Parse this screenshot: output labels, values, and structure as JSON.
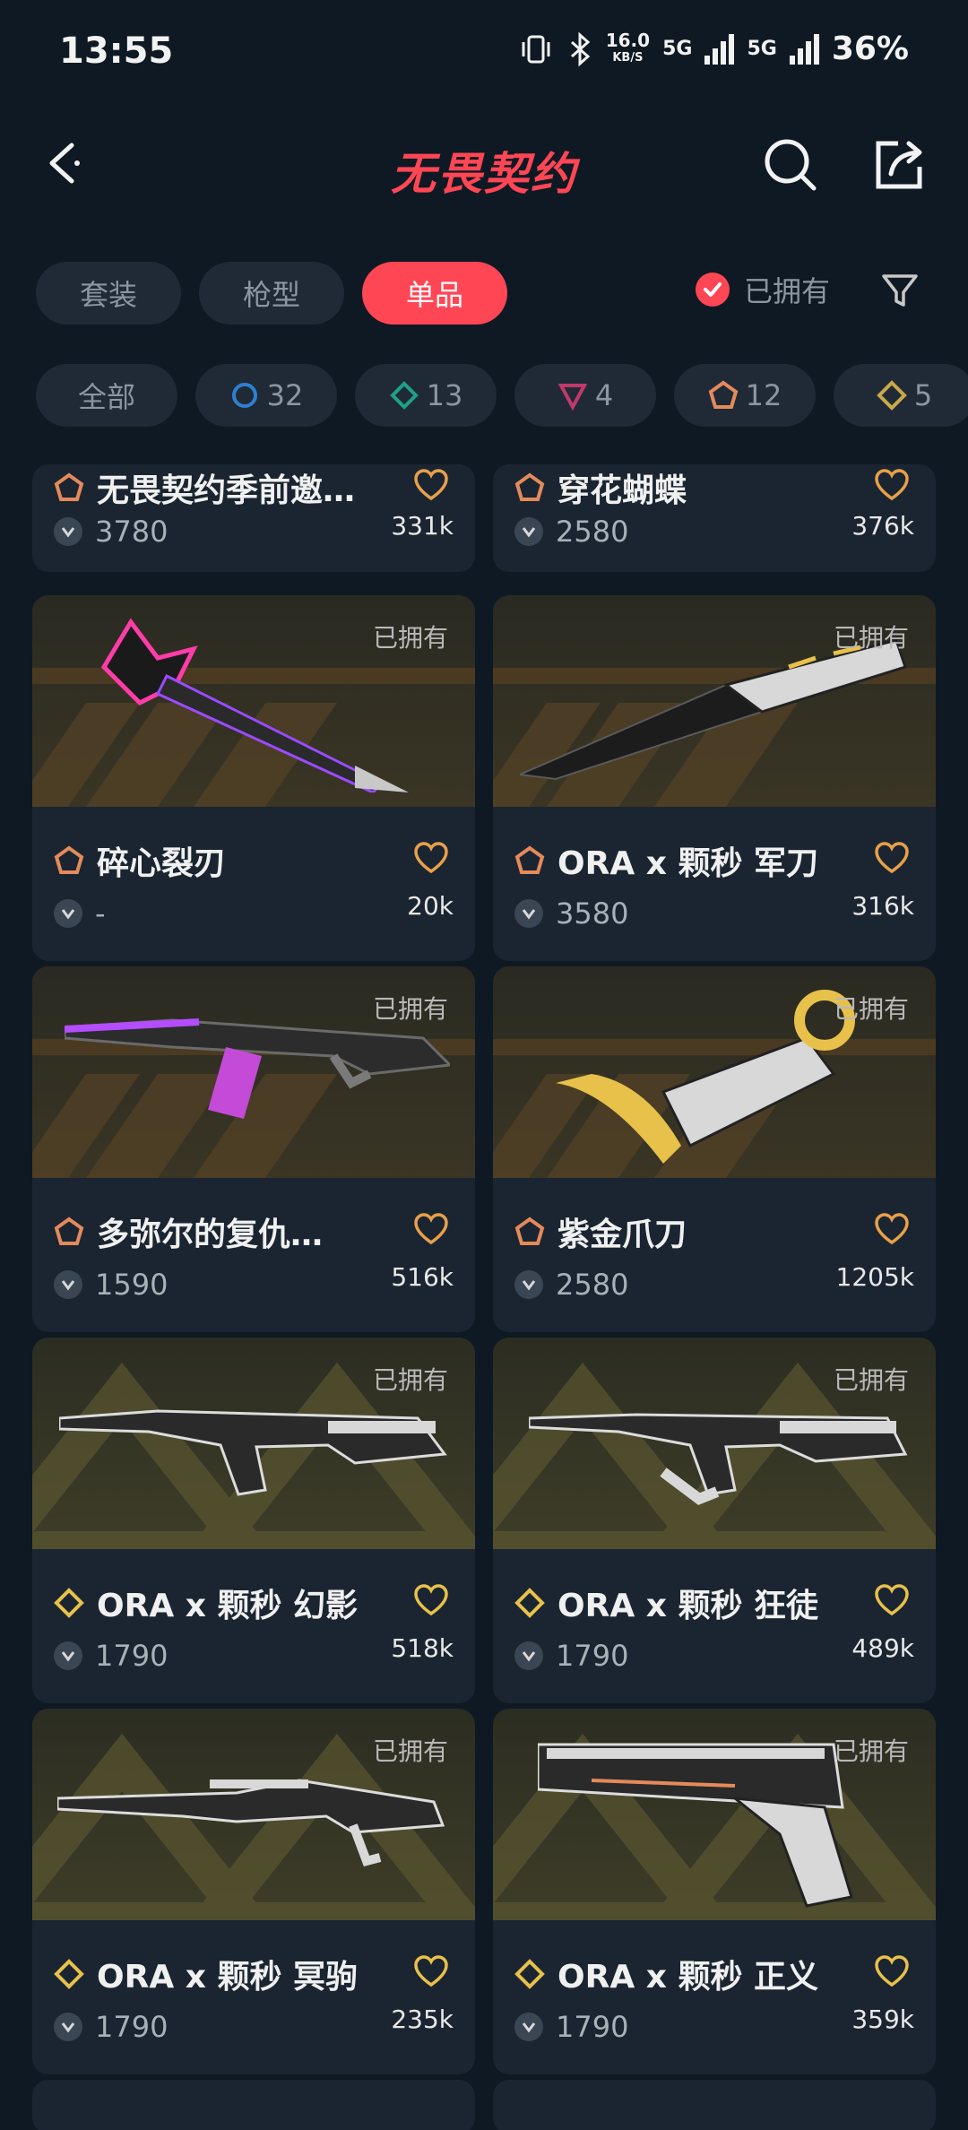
{
  "status_bar": {
    "time": "13:55",
    "net_speed": "16.0",
    "net_unit": "KB/S",
    "sig1": "5G",
    "sig2": "5G",
    "battery": "36%"
  },
  "header": {
    "title": "无畏契约"
  },
  "tabs": [
    {
      "label": "套装"
    },
    {
      "label": "枪型"
    },
    {
      "label": "单品"
    }
  ],
  "owned_filter": {
    "label": "已拥有"
  },
  "chips": [
    {
      "label": "全部"
    },
    {
      "label": "32",
      "color": "#2e7fd0"
    },
    {
      "label": "13",
      "color": "#1fa088"
    },
    {
      "label": "4",
      "color": "#c0396a"
    },
    {
      "label": "12",
      "color": "#e58a5a"
    },
    {
      "label": "5",
      "color": "#c9a84a"
    }
  ],
  "items": [
    {
      "name": "无畏契约季前邀…",
      "price": "3780",
      "likes": "331k",
      "tier_color": "#e58a5a",
      "owned": ""
    },
    {
      "name": "穿花蝴蝶",
      "price": "2580",
      "likes": "376k",
      "tier_color": "#e58a5a",
      "owned": ""
    },
    {
      "name": "碎心裂刃",
      "price": "-",
      "likes": "20k",
      "tier_color": "#e58a5a",
      "owned": "已拥有"
    },
    {
      "name": "ORA x 颗秒 军刀",
      "price": "3580",
      "likes": "316k",
      "tier_color": "#e58a5a",
      "owned": "已拥有"
    },
    {
      "name": "多弥尔的复仇…",
      "price": "1590",
      "likes": "516k",
      "tier_color": "#e58a5a",
      "owned": "已拥有"
    },
    {
      "name": "紫金爪刀",
      "price": "2580",
      "likes": "1205k",
      "tier_color": "#e58a5a",
      "owned": "已拥有"
    },
    {
      "name": "ORA x 颗秒 幻影",
      "price": "1790",
      "likes": "518k",
      "tier_color": "#e8c14a",
      "owned": "已拥有"
    },
    {
      "name": "ORA x 颗秒 狂徒",
      "price": "1790",
      "likes": "489k",
      "tier_color": "#e8c14a",
      "owned": "已拥有"
    },
    {
      "name": "ORA x 颗秒 冥驹",
      "price": "1790",
      "likes": "235k",
      "tier_color": "#e8c14a",
      "owned": "已拥有"
    },
    {
      "name": "ORA x 颗秒 正义",
      "price": "1790",
      "likes": "359k",
      "tier_color": "#e8c14a",
      "owned": "已拥有"
    }
  ]
}
